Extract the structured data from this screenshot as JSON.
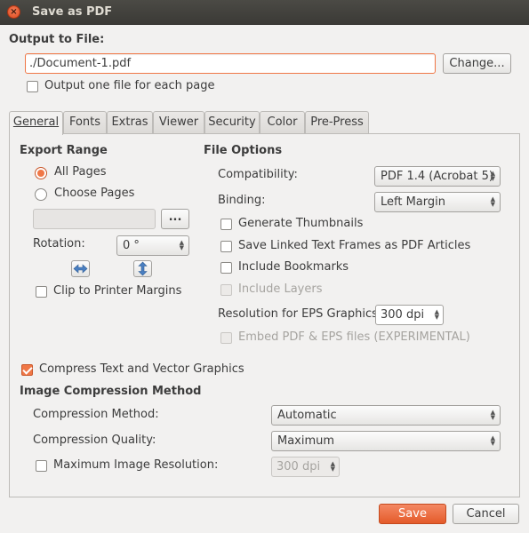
{
  "window": {
    "title": "Save as PDF",
    "close_glyph": "×"
  },
  "output": {
    "heading": "Output to File:",
    "file_value": "./Document-1.pdf",
    "change_button": "Change...",
    "one_file_per_page_label": "Output one file for each page",
    "one_file_per_page_checked": false
  },
  "tabs": [
    {
      "label": "General",
      "active": true
    },
    {
      "label": "Fonts",
      "active": false
    },
    {
      "label": "Extras",
      "active": false
    },
    {
      "label": "Viewer",
      "active": false
    },
    {
      "label": "Security",
      "active": false
    },
    {
      "label": "Color",
      "active": false
    },
    {
      "label": "Pre-Press",
      "active": false
    }
  ],
  "export_range": {
    "heading": "Export Range",
    "all_pages_label": "All Pages",
    "all_pages_selected": true,
    "choose_pages_label": "Choose Pages",
    "choose_pages_selected": false,
    "pages_value": "",
    "browse_button": "...",
    "rotation_label": "Rotation:",
    "rotation_value": "0 °",
    "flip_horizontal_icon": "flip-horizontal-icon",
    "flip_vertical_icon": "flip-vertical-icon",
    "clip_label": "Clip to Printer Margins",
    "clip_checked": false
  },
  "file_options": {
    "heading": "File Options",
    "compatibility_label": "Compatibility:",
    "compatibility_value": "PDF 1.4 (Acrobat 5)",
    "binding_label": "Binding:",
    "binding_value": "Left Margin",
    "generate_thumbnails_label": "Generate Thumbnails",
    "generate_thumbnails_checked": false,
    "save_linked_label": "Save Linked Text Frames as PDF Articles",
    "save_linked_checked": false,
    "include_bookmarks_label": "Include Bookmarks",
    "include_bookmarks_checked": false,
    "include_layers_label": "Include Layers",
    "include_layers_enabled": false,
    "resolution_label": "Resolution for EPS Graphics:",
    "resolution_value": "300 dpi",
    "embed_label": "Embed PDF & EPS files (EXPERIMENTAL)",
    "embed_enabled": false
  },
  "compression": {
    "compress_label": "Compress Text and Vector Graphics",
    "compress_checked": true,
    "heading": "Image Compression Method",
    "method_label": "Compression Method:",
    "method_value": "Automatic",
    "quality_label": "Compression Quality:",
    "quality_value": "Maximum",
    "max_res_label": "Maximum Image Resolution:",
    "max_res_checked": false,
    "max_res_value": "300 dpi"
  },
  "footer": {
    "save_button": "Save",
    "cancel_button": "Cancel"
  },
  "colors": {
    "accent": "#f07746",
    "titlebar": "#3b3a36",
    "background": "#f2f1f0"
  }
}
